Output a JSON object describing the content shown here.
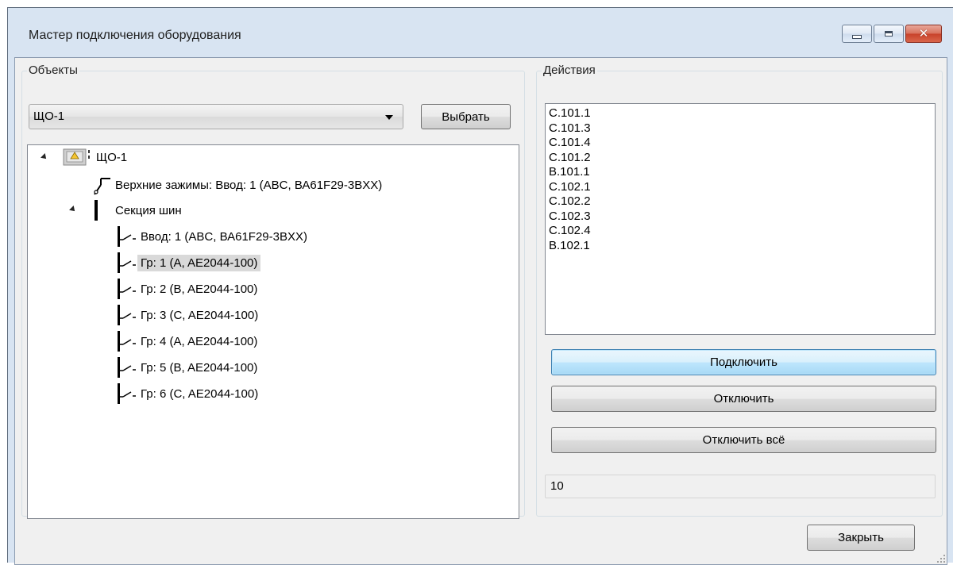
{
  "window": {
    "title": "Мастер подключения оборудования",
    "close_glyph": "✕"
  },
  "objects": {
    "label": "Объекты",
    "combo_value": "ЩО-1",
    "select_button": "Выбрать",
    "tree": {
      "root": "ЩО-1",
      "upper_terminals": "Верхние зажимы: Ввод: 1 (ABC, ВА61F29-3BXX)",
      "bus_section": "Секция шин",
      "children": [
        "Ввод: 1 (ABC, ВА61F29-3BXX)",
        "Гр: 1 (A, AE2044-100)",
        "Гр: 2 (B, AE2044-100)",
        "Гр: 3 (C, AE2044-100)",
        "Гр: 4 (A, AE2044-100)",
        "Гр: 5 (B, AE2044-100)",
        "Гр: 6 (C, AE2044-100)"
      ],
      "selected_index": 1
    }
  },
  "actions": {
    "label": "Действия",
    "items": [
      "C.101.1",
      "C.101.3",
      "C.101.4",
      "C.101.2",
      "B.101.1",
      "C.102.1",
      "C.102.2",
      "C.102.3",
      "C.102.4",
      "B.102.1"
    ],
    "connect": "Подключить",
    "disconnect": "Отключить",
    "disconnect_all": "Отключить всё",
    "count": "10"
  },
  "footer": {
    "close_button": "Закрыть"
  },
  "icons": {
    "panel": "panel-warning-icon",
    "upper_terminal": "switch-terminal-icon",
    "bus": "bus-bar-icon",
    "breaker": "breaker-icon"
  },
  "colors": {
    "frame": "#d8e4f2",
    "client": "#f0f0f0",
    "close_button": "#c8412a",
    "focus_border": "#3c7fb1",
    "selection": "#d9d9d9"
  }
}
